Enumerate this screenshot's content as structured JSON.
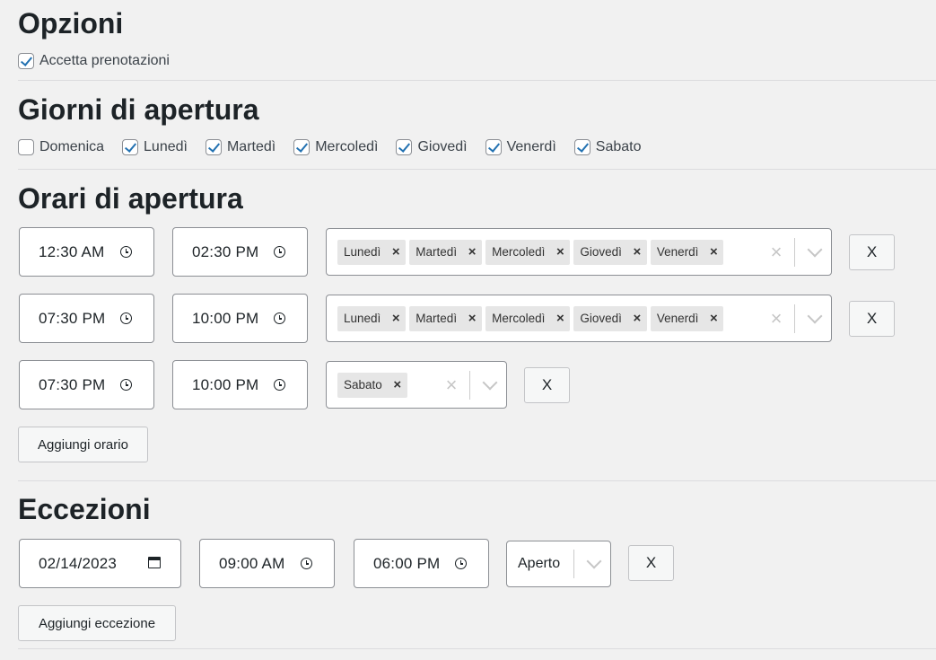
{
  "options": {
    "title": "Opzioni",
    "accept_bookings": {
      "label": "Accetta prenotazioni",
      "checked": true
    }
  },
  "days": {
    "title": "Giorni di apertura",
    "items": [
      {
        "label": "Domenica",
        "checked": false
      },
      {
        "label": "Lunedì",
        "checked": true
      },
      {
        "label": "Martedì",
        "checked": true
      },
      {
        "label": "Mercoledì",
        "checked": true
      },
      {
        "label": "Giovedì",
        "checked": true
      },
      {
        "label": "Venerdì",
        "checked": true
      },
      {
        "label": "Sabato",
        "checked": true
      }
    ]
  },
  "hours": {
    "title": "Orari di apertura",
    "rows": [
      {
        "from": "12:30 AM",
        "to": "02:30 PM",
        "days": [
          "Lunedì",
          "Martedì",
          "Mercoledì",
          "Giovedì",
          "Venerdì"
        ],
        "remove_label": "X"
      },
      {
        "from": "07:30 PM",
        "to": "10:00 PM",
        "days": [
          "Lunedì",
          "Martedì",
          "Mercoledì",
          "Giovedì",
          "Venerdì"
        ],
        "remove_label": "X"
      },
      {
        "from": "07:30 PM",
        "to": "10:00 PM",
        "days": [
          "Sabato"
        ],
        "remove_label": "X"
      }
    ],
    "add_label": "Aggiungi orario"
  },
  "exceptions": {
    "title": "Eccezioni",
    "rows": [
      {
        "date": "02/14/2023",
        "from": "09:00 AM",
        "to": "06:00 PM",
        "status": "Aperto",
        "remove_label": "X"
      }
    ],
    "add_label": "Aggiungi eccezione"
  },
  "colors": {
    "background": "#f1f1f1",
    "accent": "#2271b1",
    "tag_bg": "#e6e6e6"
  }
}
